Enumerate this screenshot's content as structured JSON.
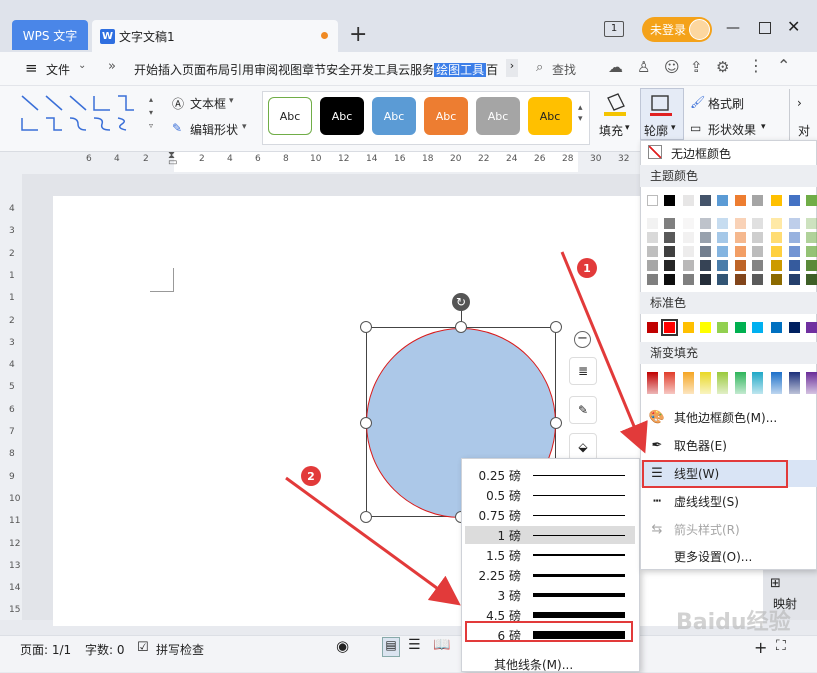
{
  "app": {
    "brand_tab": "WPS 文字",
    "doc_tab": "文字文稿1",
    "doc_icon": "W",
    "login": "未登录",
    "tab_counter": "1"
  },
  "menu": {
    "file": "文件",
    "items": [
      "开始",
      "插入",
      "页面布局",
      "引用",
      "审阅",
      "视图",
      "章节",
      "安全",
      "开发工具",
      "云服务",
      "绘图工具",
      "百"
    ],
    "active": "绘图工具",
    "search": "查找"
  },
  "ribbon": {
    "textbox": "文本框",
    "edit_shape": "编辑形状",
    "style_samples": [
      "Abc",
      "Abc",
      "Abc",
      "Abc",
      "Abc",
      "Abc"
    ],
    "style_colors": [
      "#ffffff",
      "#000000",
      "#5b9bd5",
      "#ed7d31",
      "#a5a5a5",
      "#ffc000"
    ],
    "fill": "填充",
    "outline": "轮廓",
    "format_painter": "格式刷",
    "shape_effect": "形状效果",
    "more": "对"
  },
  "ruler_h": [
    "6",
    "4",
    "2",
    "2",
    "4",
    "6",
    "8",
    "10",
    "12",
    "14",
    "16",
    "18",
    "20",
    "22",
    "24",
    "26",
    "28",
    "30",
    "32",
    "34"
  ],
  "ruler_v": [
    "4",
    "3",
    "2",
    "1",
    "1",
    "2",
    "3",
    "4",
    "5",
    "6",
    "7",
    "8",
    "9",
    "10",
    "11",
    "12",
    "13",
    "14",
    "15"
  ],
  "status": {
    "page": "页面: 1/1",
    "words": "字数: 0",
    "spell": "拼写检查"
  },
  "line_weights": {
    "items": [
      "0.25 磅",
      "0.5 磅",
      "0.75 磅",
      "1 磅",
      "1.5 磅",
      "2.25 磅",
      "3 磅",
      "4.5 磅",
      "6 磅"
    ],
    "thickness_pt": [
      0.25,
      0.5,
      0.75,
      1,
      1.5,
      2.25,
      3,
      4.5,
      6
    ],
    "selected": "1 磅",
    "highlighted": "6 磅",
    "more": "其他线条(M)..."
  },
  "color_menu": {
    "no_border": "无边框颜色",
    "theme_colors": "主题颜色",
    "standard_colors": "标准色",
    "gradient_fill": "渐变填充",
    "theme_top": [
      "#ffffff",
      "#000000",
      "#e7e6e6",
      "#44546a",
      "#5b9bd5",
      "#ed7d31",
      "#a5a5a5",
      "#ffc000",
      "#4472c4",
      "#70ad47"
    ],
    "standard": [
      "#c00000",
      "#ff0000",
      "#ffc000",
      "#ffff00",
      "#92d050",
      "#00b050",
      "#00b0f0",
      "#0070c0",
      "#002060",
      "#7030a0"
    ],
    "gradient": [
      "#c00000",
      "#e03c2a",
      "#f5a623",
      "#e9d825",
      "#9ac93c",
      "#2eb55a",
      "#1fa8c7",
      "#1c6fc9",
      "#1b2f7a",
      "#6a2c98"
    ],
    "other_colors": "其他边框颜色(M)...",
    "picker": "取色器(E)",
    "line_type": "线型(W)",
    "dash_type": "虚线线型(S)",
    "arrow_style": "箭头样式(R)",
    "more_settings": "更多设置(O)..."
  },
  "annotations": {
    "step1": "1",
    "step2": "2"
  },
  "side": {
    "mapping": "映射"
  },
  "watermark": "Baidu经验"
}
